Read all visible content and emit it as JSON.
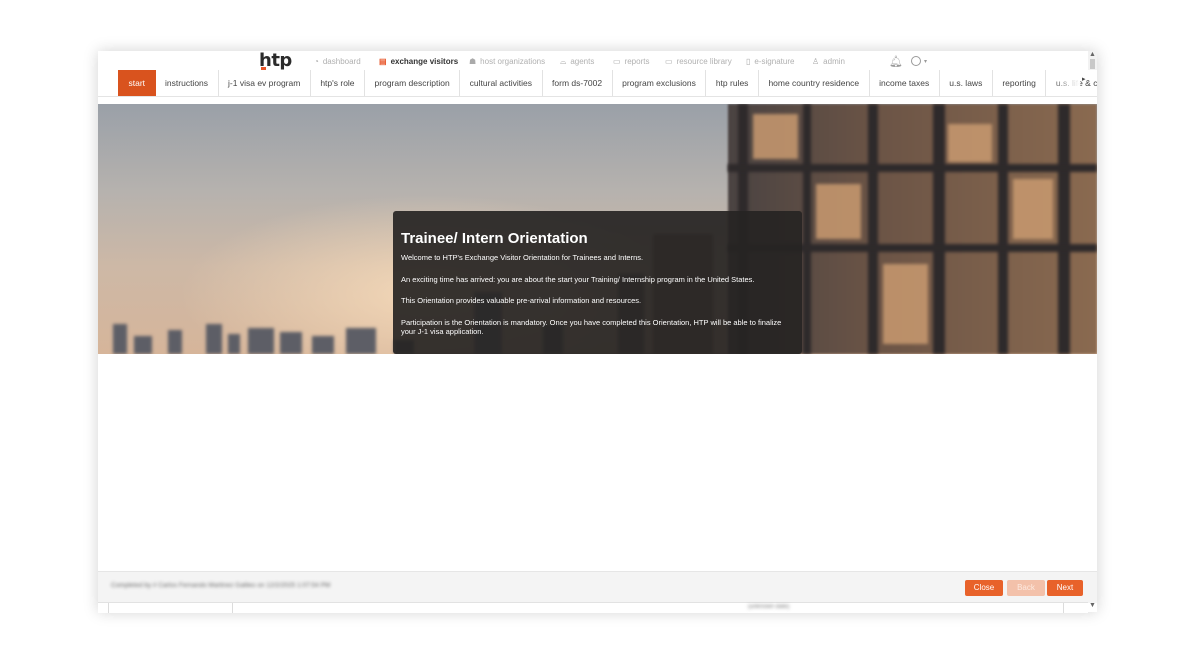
{
  "brand": {
    "logo": "htp",
    "accent_color": "#e8562a"
  },
  "topnav": {
    "items": [
      {
        "label": "dashboard",
        "icon": "dashboard-icon"
      },
      {
        "label": "exchange visitors",
        "icon": "id-card-icon",
        "active": true
      },
      {
        "label": "host organizations",
        "icon": "users-icon"
      },
      {
        "label": "agents",
        "icon": "handshake-icon"
      },
      {
        "label": "reports",
        "icon": "print-icon"
      },
      {
        "label": "resource library",
        "icon": "monitor-icon"
      },
      {
        "label": "e-signature",
        "icon": "document-icon"
      },
      {
        "label": "admin",
        "icon": "user-icon"
      }
    ]
  },
  "tabs": [
    {
      "label": "start",
      "active": true
    },
    {
      "label": "instructions"
    },
    {
      "label": "j-1 visa ev program"
    },
    {
      "label": "htp's role"
    },
    {
      "label": "program description"
    },
    {
      "label": "cultural activities"
    },
    {
      "label": "form ds-7002"
    },
    {
      "label": "program exclusions"
    },
    {
      "label": "htp rules"
    },
    {
      "label": "home country residence"
    },
    {
      "label": "income taxes"
    },
    {
      "label": "u.s. laws"
    },
    {
      "label": "reporting"
    },
    {
      "label": "u.s. life & custo"
    }
  ],
  "tab_active_color": "#d9531e",
  "orientation": {
    "title": "Trainee/ Intern Orientation",
    "paragraphs": [
      "Welcome to HTP's Exchange Visitor Orientation for Trainees and Interns.",
      "An exciting time has arrived: you are about the start your Training/ Internship program in the United States.",
      "This Orientation provides valuable pre-arrival information and resources.",
      "Participation is the Orientation is mandatory. Once you have completed this Orientation, HTP will be able to finalize your J-1 visa application."
    ]
  },
  "footer": {
    "completed_by": "Completed by # Carlos Fernando Martinez Galileo on 12/2/2025 1:07:54 PM",
    "close_label": "Close",
    "back_label": "Back",
    "next_label": "Next",
    "button_color": "#e8622a"
  },
  "statusbar": {
    "text": "(unknown date)"
  }
}
